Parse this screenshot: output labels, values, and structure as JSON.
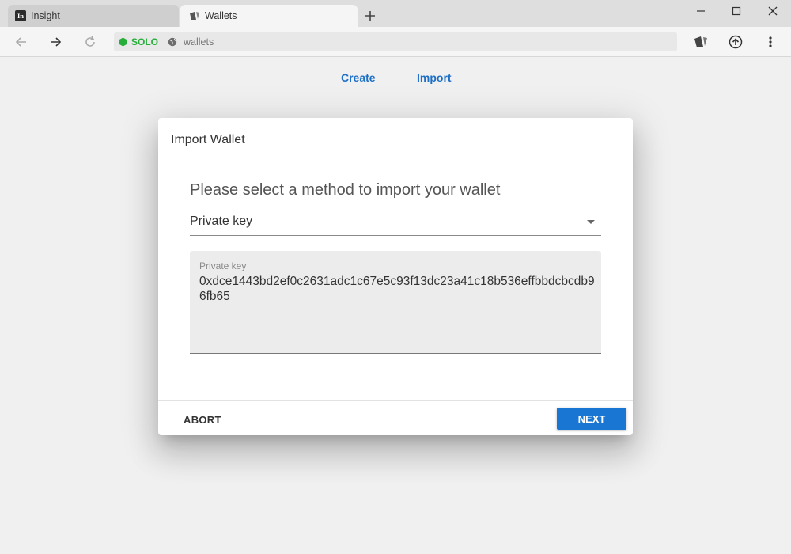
{
  "browser": {
    "tabs": [
      {
        "title": "Insight",
        "icon": "insight-favicon",
        "active": false
      },
      {
        "title": "Wallets",
        "icon": "wallets-favicon",
        "active": true
      }
    ],
    "address_bar": {
      "network_badge": "SOLO",
      "network_color": "#27ae3a",
      "url": "wallets"
    }
  },
  "page_nav": {
    "create_label": "Create",
    "import_label": "Import",
    "link_color": "#1e6fc6"
  },
  "dialog": {
    "title": "Import Wallet",
    "heading": "Please select a method to import your wallet",
    "method_select": {
      "selected": "Private key"
    },
    "key_field": {
      "label": "Private key",
      "value": "0xdce1443bd2ef0c2631adc1c67e5c93f13dc23a41c18b536effbbdcbcdb96fb65"
    },
    "abort_label": "ABORT",
    "next_label": "NEXT",
    "accent_color": "#1976d2"
  }
}
